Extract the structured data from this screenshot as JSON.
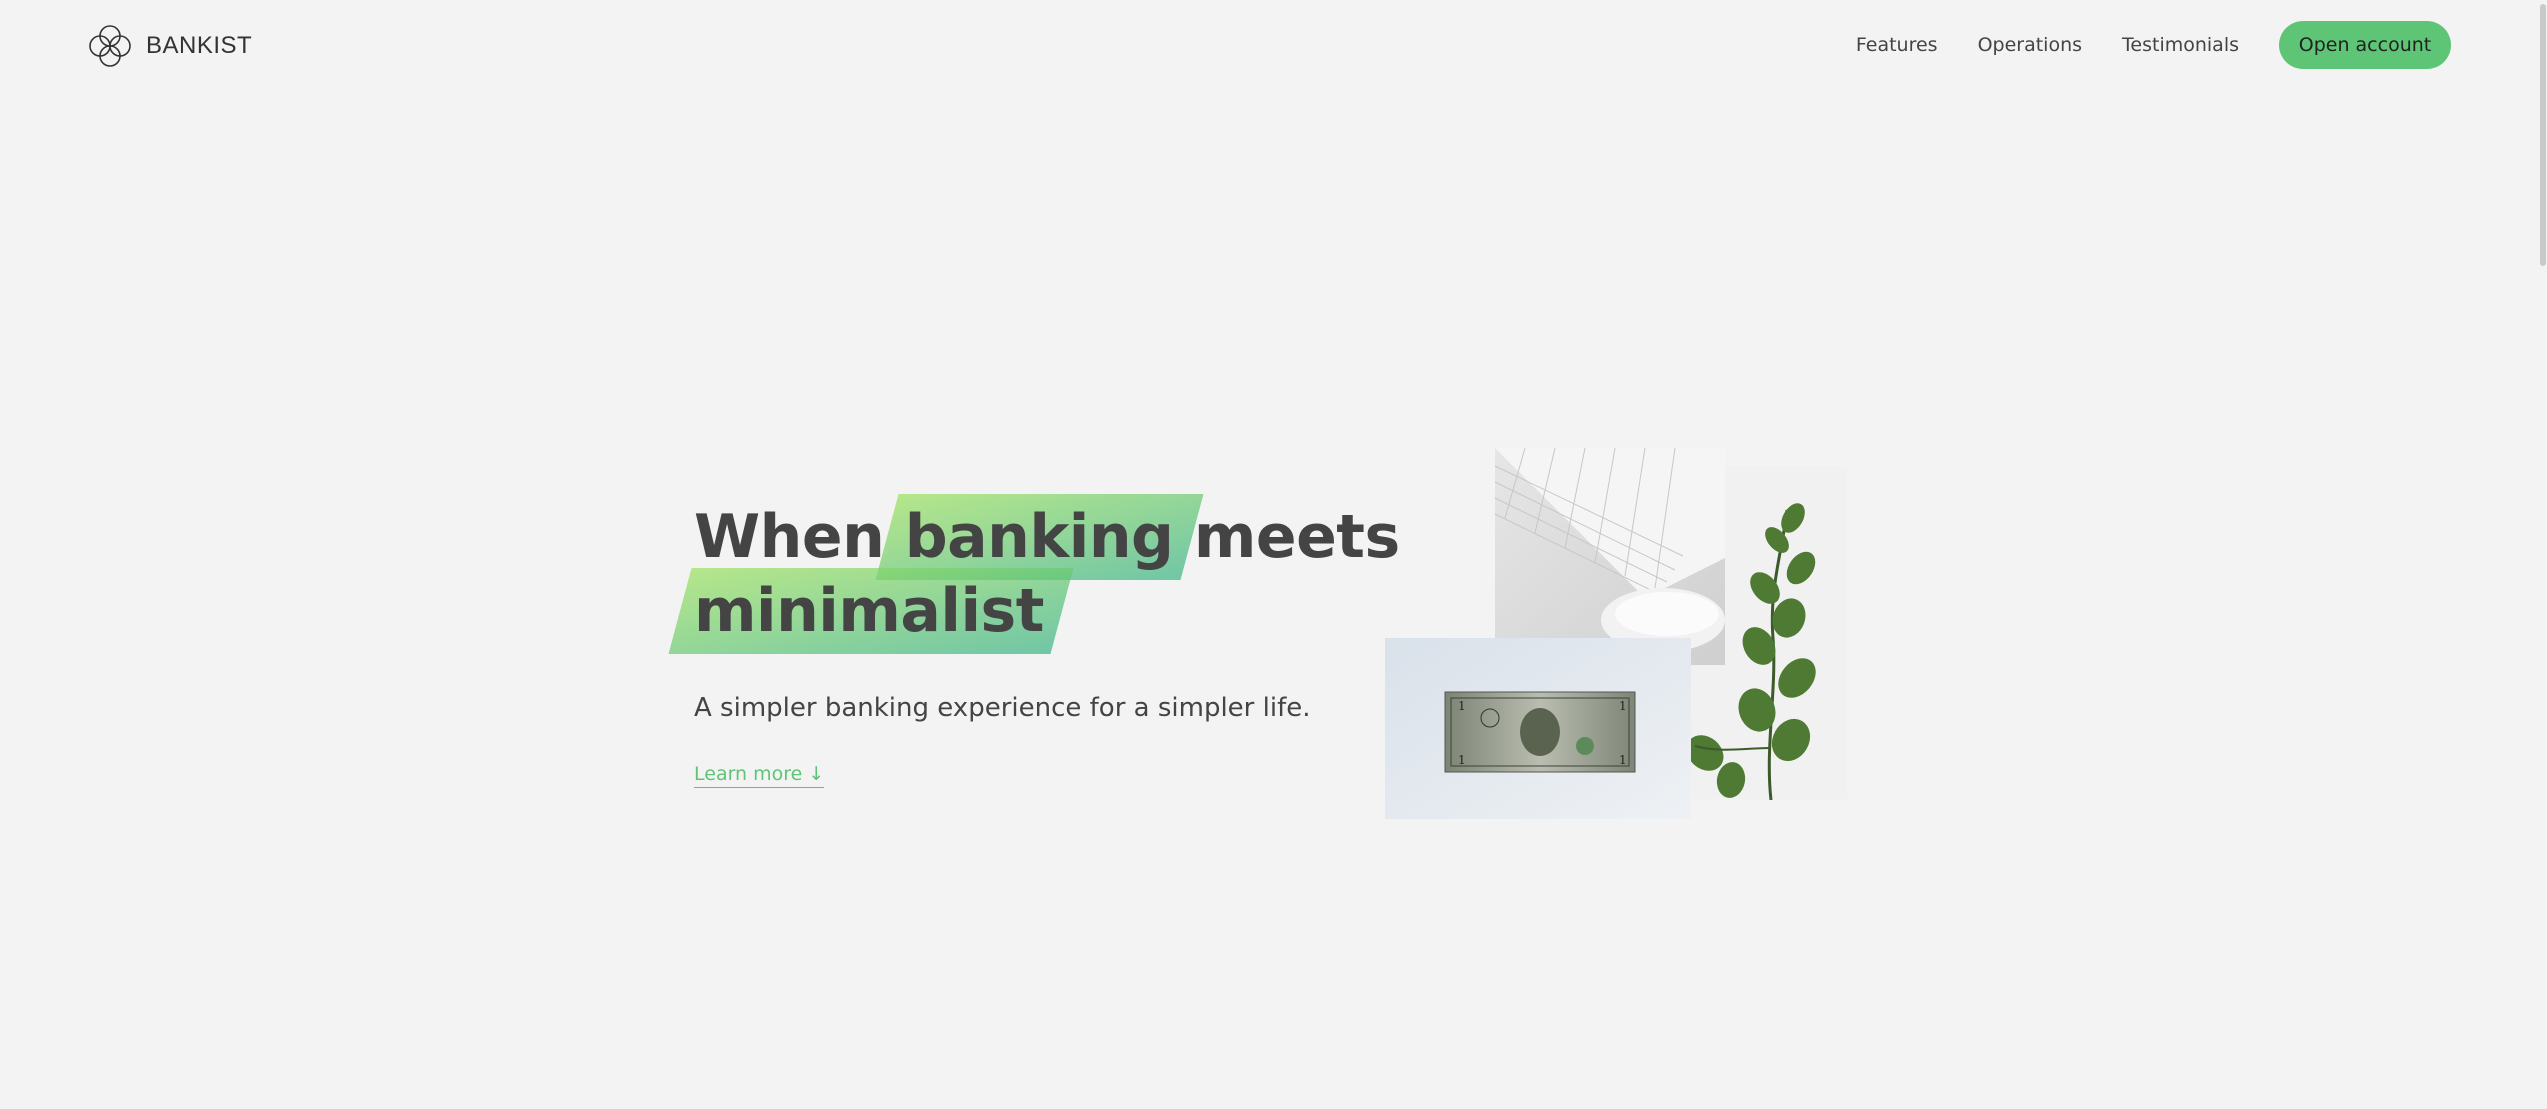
{
  "nav": {
    "logo_text": "BANKIST",
    "links": [
      "Features",
      "Operations",
      "Testimonials"
    ],
    "cta_label": "Open account"
  },
  "hero": {
    "title_word_1": "When",
    "title_highlight_1": "banking",
    "title_word_2": "meets",
    "title_highlight_2": "minimalist",
    "subtitle": "A simpler banking experience for a simpler life.",
    "learn_more": "Learn more ↓"
  },
  "colors": {
    "background": "#f3f3f3",
    "accent": "#5ec576",
    "highlight_start": "#9be15d",
    "highlight_end": "#39b385",
    "text": "#444444"
  },
  "icons": {
    "logo": "bankist-logo-icon"
  }
}
